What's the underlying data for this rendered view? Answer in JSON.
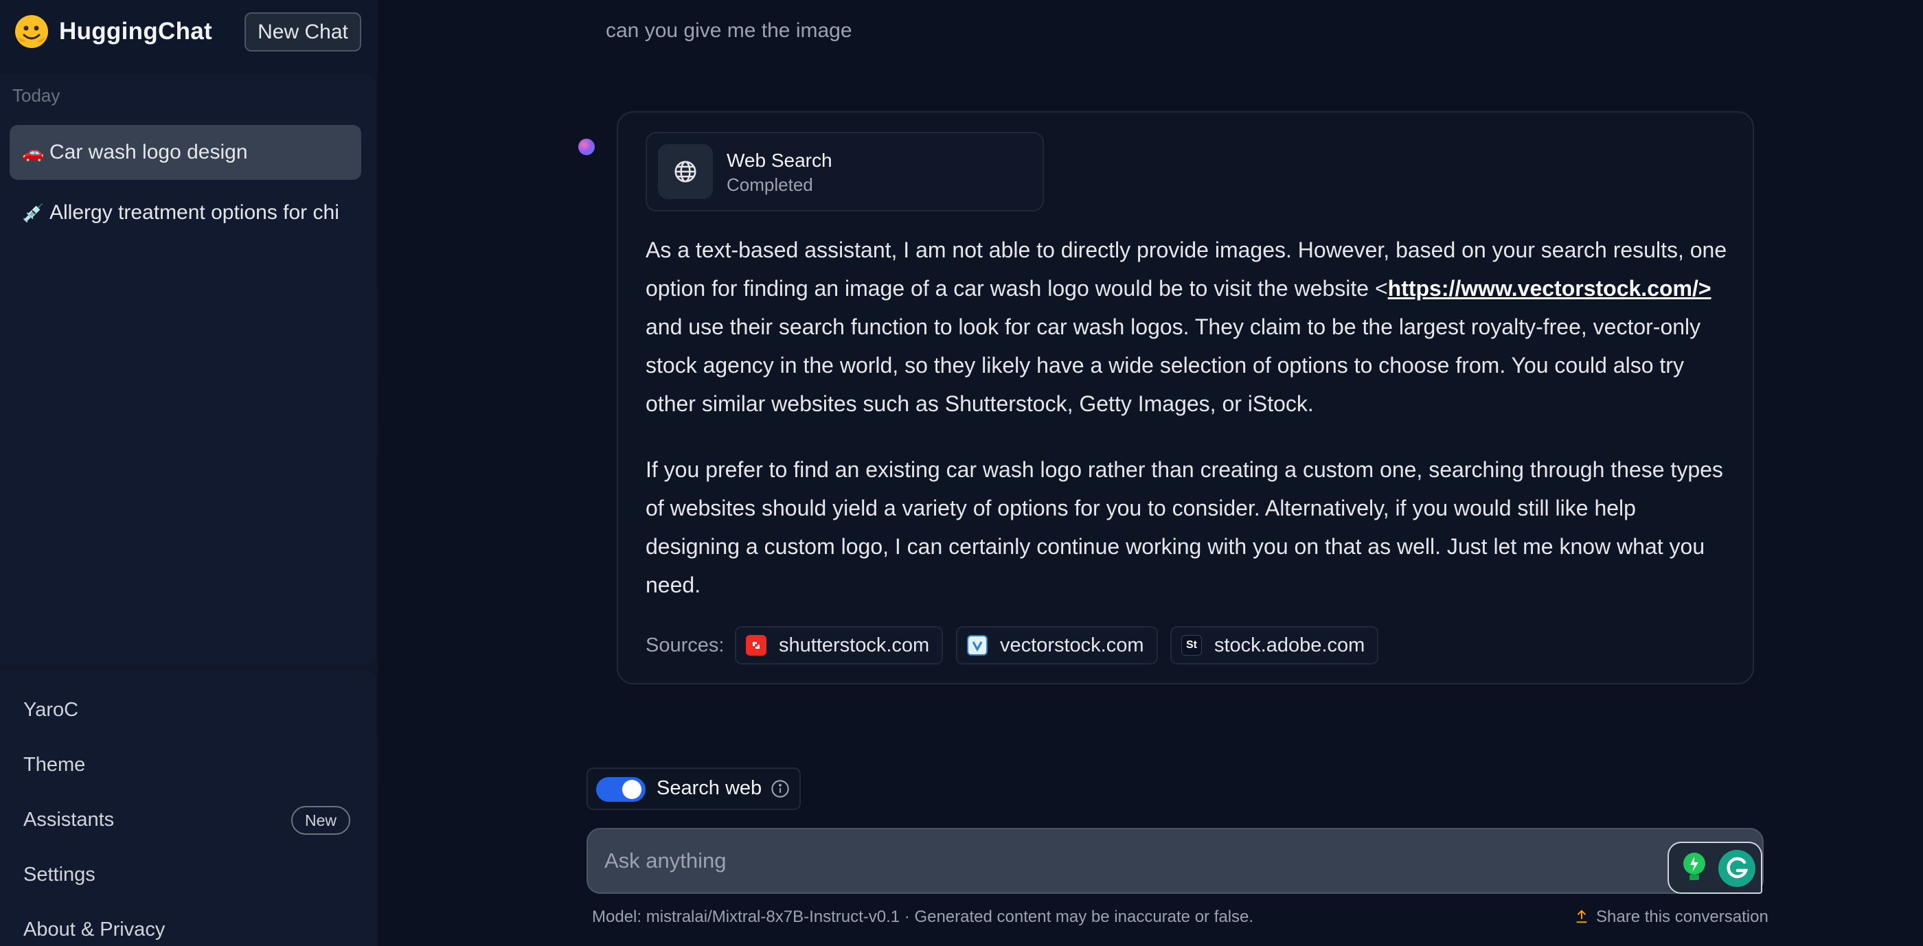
{
  "app": {
    "name": "HuggingChat",
    "new_chat_label": "New Chat"
  },
  "sidebar": {
    "section_label": "Today",
    "conversations": [
      {
        "emoji": "🚗",
        "label": "Car wash logo design",
        "active": true
      },
      {
        "emoji": "💉",
        "label": "Allergy treatment options for chi",
        "active": false
      }
    ],
    "bottom_items": {
      "user": "YaroC",
      "theme": "Theme",
      "assistants": "Assistants",
      "assistants_badge": "New",
      "settings": "Settings",
      "about": "About & Privacy"
    }
  },
  "chat": {
    "user_message": "can you give me the image",
    "web_search": {
      "title": "Web Search",
      "status": "Completed"
    },
    "answer": {
      "p1_before": "As a text-based assistant, I am not able to directly provide images. However, based on your search results, one option for finding an image of a car wash logo would be to visit the website <",
      "p1_link": "https://www.vectorstock.com/>",
      "p1_after": " and use their search function to look for car wash logos. They claim to be the largest royalty-free, vector-only stock agency in the world, so they likely have a wide selection of options to choose from. You could also try other similar websites such as Shutterstock, Getty Images, or iStock.",
      "p2": "If you prefer to find an existing car wash logo rather than creating a custom one, searching through these types of websites should yield a variety of options for you to consider. Alternatively, if you would still like help designing a custom logo, I can certainly continue working with you on that as well. Just let me know what you need."
    },
    "sources_label": "Sources:",
    "sources": [
      {
        "domain": "shutterstock.com",
        "icon": "shutterstock-icon",
        "color": "#ee2b24"
      },
      {
        "domain": "vectorstock.com",
        "icon": "vectorstock-icon",
        "color": "#2f7fc1"
      },
      {
        "domain": "stock.adobe.com",
        "icon": "adobe-stock-icon",
        "icon_text": "St",
        "color": "#0b1120"
      }
    ]
  },
  "composer": {
    "search_web_label": "Search web",
    "search_web_enabled": true,
    "placeholder": "Ask anything"
  },
  "footer": {
    "model_text": "Model: mistralai/Mixtral-8x7B-Instruct-v0.1 · Generated content may be inaccurate or false.",
    "share_label": "Share this conversation"
  },
  "colors": {
    "background": "#0b1120",
    "accent": "#2563eb",
    "brand_yellow": "#fbbf24"
  }
}
